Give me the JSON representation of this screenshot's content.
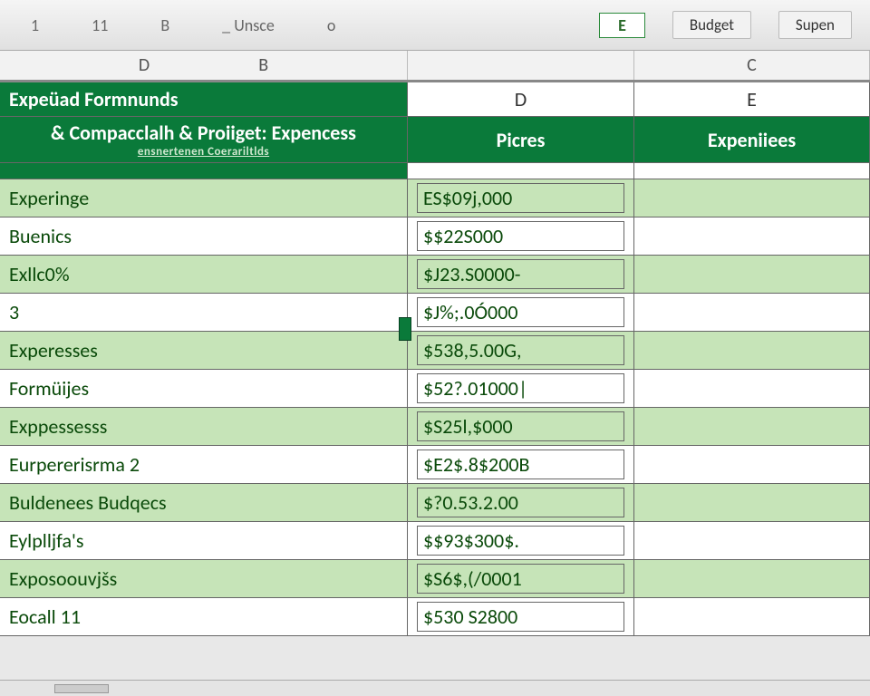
{
  "colors": {
    "header_green": "#0a7a3a",
    "row_green": "#c6e4b8",
    "text_green": "#0a4a0a"
  },
  "top": {
    "ref1": "1",
    "ref2": "11",
    "ref3": "B",
    "ref4": "_ Unsce",
    "ref5": "o",
    "ref6_boxed": "E",
    "btn_budget": "Budget",
    "btn_supen": "Supen"
  },
  "outer_cols": {
    "a": "D",
    "b": "B",
    "c": "C"
  },
  "inner_cols": {
    "d": "D",
    "e": "E"
  },
  "banner1": "Expeüad Formnunds",
  "banner2_main": "& Compacclalh & Proiiget: Expencess",
  "banner2_sub": "ensnertenen Coerariltlds",
  "col_head_d": "Picres",
  "col_head_e": "Expeniiees",
  "rows": [
    {
      "label": "Experinge",
      "value": "ES$09j,000",
      "alt": "green"
    },
    {
      "label": "Buenics",
      "value": "$$22S000",
      "alt": "white"
    },
    {
      "label": "Exllc0%",
      "value": "$J23.S0000-",
      "alt": "green"
    },
    {
      "label": "3",
      "value": "$J%;.0Ó000",
      "alt": "white"
    },
    {
      "label": "Experesses",
      "value": "$538,5.00G,",
      "alt": "green"
    },
    {
      "label": "Formüijes",
      "value": "$52?.01000|",
      "alt": "white"
    },
    {
      "label": "Exppessesss",
      "value": "$S25l,$000",
      "alt": "green"
    },
    {
      "label": "Eurpererisrma 2",
      "value": "$E2$.8$200B",
      "alt": "white"
    },
    {
      "label": "Buldenees Budqecs",
      "value": "$?0.53.2.00",
      "alt": "green"
    },
    {
      "label": "Eylplljfa's",
      "value": "$$93$300$.",
      "alt": "white"
    },
    {
      "label": "Exposoouvjšs",
      "value": "$S6$,(/0001",
      "alt": "green"
    },
    {
      "label": "Eocall 11",
      "value": "$530 S2800",
      "alt": "white"
    }
  ]
}
